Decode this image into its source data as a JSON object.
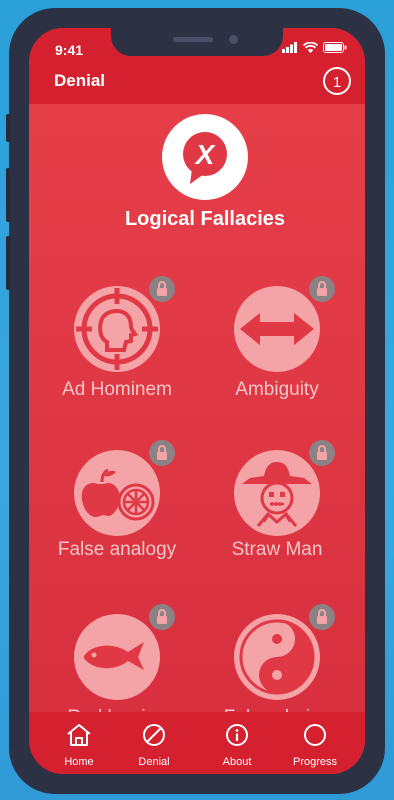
{
  "status_bar": {
    "time": "9:41"
  },
  "appbar": {
    "title": "Denial",
    "counter": "1"
  },
  "main": {
    "app_title": "Logical Fallacies",
    "logo_mark": "X",
    "fallacies": [
      {
        "label": "Ad Hominem",
        "icon": "head-target-icon",
        "locked": true
      },
      {
        "label": "Ambiguity",
        "icon": "double-arrow-icon",
        "locked": true
      },
      {
        "label": "False analogy",
        "icon": "apple-orange-icon",
        "locked": true
      },
      {
        "label": "Straw Man",
        "icon": "scarecrow-icon",
        "locked": true
      },
      {
        "label": "Red herring",
        "icon": "fish-icon",
        "locked": true
      },
      {
        "label": "False choice",
        "icon": "yin-yang-icon",
        "locked": true
      }
    ]
  },
  "bottom_nav": [
    {
      "label": "Home",
      "icon": "home-icon"
    },
    {
      "label": "Denial",
      "icon": "prohibited-icon"
    },
    {
      "label": "About",
      "icon": "info-icon"
    },
    {
      "label": "Progress",
      "icon": "circle-progress-icon"
    }
  ],
  "colors": {
    "bar": "#d4202f",
    "screen": "#e03845",
    "circle": "#f4a3a7",
    "lock": "#8a8285"
  }
}
